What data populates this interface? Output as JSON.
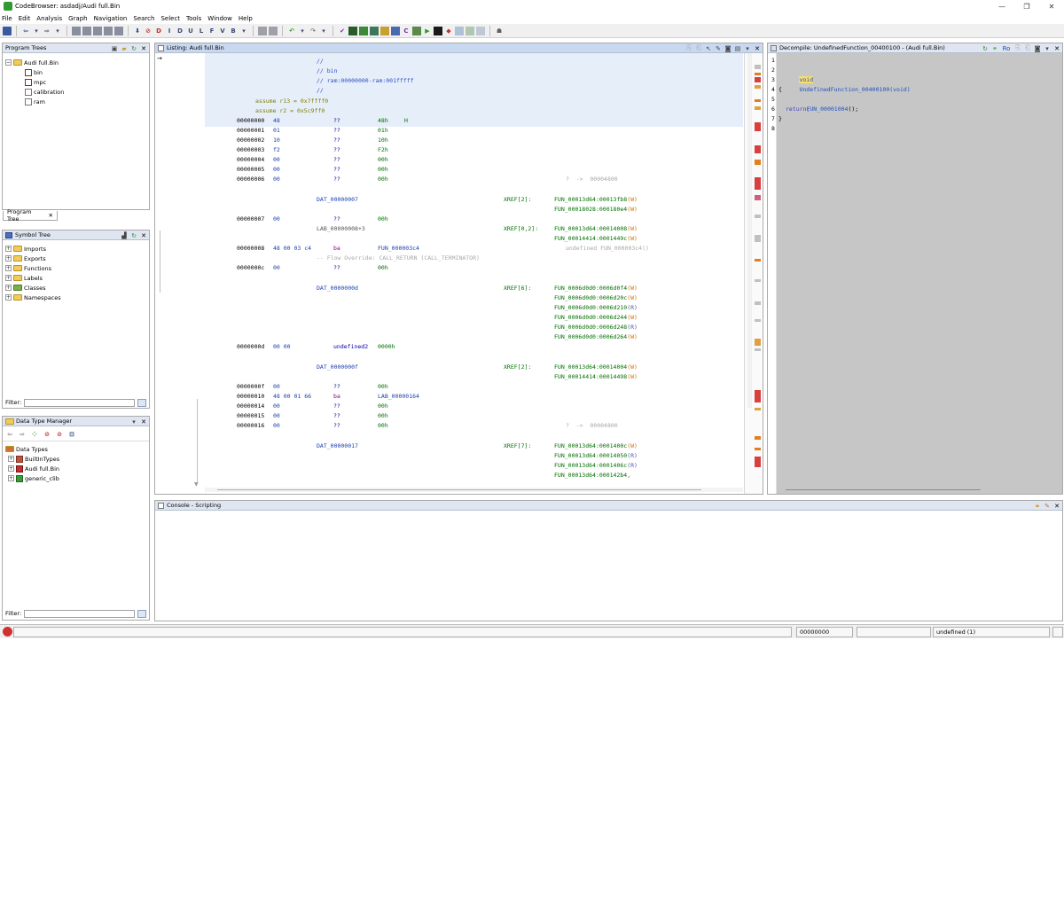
{
  "window": {
    "title": "CodeBrowser: asdadj/Audi full.Bin",
    "controls": [
      "—",
      "❐",
      "✕"
    ]
  },
  "menu": [
    "File",
    "Edit",
    "Analysis",
    "Graph",
    "Navigation",
    "Search",
    "Select",
    "Tools",
    "Window",
    "Help"
  ],
  "program_trees": {
    "header": "Program Trees",
    "root": "Audi full.Bin",
    "items": [
      "bin",
      "mpc",
      "calibration",
      "ram"
    ],
    "tab_label": "Program Tree"
  },
  "symbol_tree": {
    "header": "Symbol Tree",
    "items": [
      "Imports",
      "Exports",
      "Functions",
      "Labels",
      "Classes",
      "Namespaces"
    ],
    "filter_label": "Filter:"
  },
  "data_type_manager": {
    "header": "Data Type Manager",
    "root": "Data Types",
    "items": [
      "BuiltInTypes",
      "Audi full.Bin",
      "generic_clib"
    ],
    "filter_label": "Filter:"
  },
  "listing": {
    "header": "Listing:  Audi full.Bin",
    "comments": [
      "//",
      "// bin",
      "// ram:00000000-ram:001fffff",
      "//"
    ],
    "assumes": [
      "assume r13 = 0x7ffff0",
      "assume r2 = 0x5c9ff0"
    ],
    "first_row": {
      "addr": "00000000",
      "bytes": "48",
      "mnem": "??",
      "oper": "48h",
      "extra": "H"
    },
    "rows": [
      {
        "addr": "00000001",
        "bytes": "01",
        "mnem": "??",
        "oper": "01h"
      },
      {
        "addr": "00000002",
        "bytes": "10",
        "mnem": "??",
        "oper": "10h"
      },
      {
        "addr": "00000003",
        "bytes": "f2",
        "mnem": "??",
        "oper": "F2h"
      },
      {
        "addr": "00000004",
        "bytes": "00",
        "mnem": "??",
        "oper": "00h"
      },
      {
        "addr": "00000005",
        "bytes": "00",
        "mnem": "??",
        "oper": "00h"
      },
      {
        "addr": "00000006",
        "bytes": "00",
        "mnem": "??",
        "oper": "00h",
        "ptr": "?  ->  00004800"
      }
    ],
    "dat7": {
      "label": "DAT_00000007",
      "xref_label": "XREF[2]:",
      "xrefs": [
        {
          "text": "FUN_00013d64:00013fb8",
          "mode": "(W)"
        },
        {
          "text": "FUN_00018028:000180e4",
          "mode": "(W)"
        }
      ],
      "row": {
        "addr": "00000007",
        "bytes": "00",
        "mnem": "??",
        "oper": "00h"
      }
    },
    "lab8": {
      "label": "LAB_00000008+3",
      "xref_label": "XREF[0,2]:",
      "xrefs": [
        {
          "text": "FUN_00013d64:00014008",
          "mode": "(W)"
        },
        {
          "text": "FUN_00014414:0001449c",
          "mode": "(W)"
        }
      ],
      "row": {
        "addr": "00000008",
        "bytes": "48 00 03 c4",
        "mnem": "ba",
        "oper": "FUN_000003c4"
      },
      "undefined_note": "undefined FUN_000003c4()",
      "flow_override": "-- Flow Override: CALL_RETURN (CALL_TERMINATOR)",
      "row_c": {
        "addr": "0000000c",
        "bytes": "00",
        "mnem": "??",
        "oper": "00h"
      }
    },
    "datd": {
      "label": "DAT_0000000d",
      "xref_label": "XREF[6]:",
      "xrefs": [
        {
          "text": "FUN_0006d0d0:0006d0f4",
          "mode": "(W)"
        },
        {
          "text": "FUN_0006d0d0:0006d20c",
          "mode": "(W)"
        },
        {
          "text": "FUN_0006d0d0:0006d210",
          "mode": "(R)"
        },
        {
          "text": "FUN_0006d0d0:0006d244",
          "mode": "(W)"
        },
        {
          "text": "FUN_0006d0d0:0006d248",
          "mode": "(R)"
        },
        {
          "text": "FUN_0006d0d0:0006d264",
          "mode": "(W)"
        }
      ],
      "row": {
        "addr": "0000000d",
        "bytes": "00 00",
        "mnem": "undefined2",
        "oper": "0000h"
      }
    },
    "datf": {
      "label": "DAT_0000000f",
      "xref_label": "XREF[2]:",
      "xrefs": [
        {
          "text": "FUN_00013d64:00014004",
          "mode": "(W)"
        },
        {
          "text": "FUN_00014414:00014498",
          "mode": "(W)"
        }
      ],
      "rows": [
        {
          "addr": "0000000f",
          "bytes": "00",
          "mnem": "??",
          "oper": "00h"
        },
        {
          "addr": "00000010",
          "bytes": "48 00 01 66",
          "mnem": "ba",
          "oper": "LAB_00000164"
        },
        {
          "addr": "00000014",
          "bytes": "00",
          "mnem": "??",
          "oper": "00h"
        },
        {
          "addr": "00000015",
          "bytes": "00",
          "mnem": "??",
          "oper": "00h"
        },
        {
          "addr": "00000016",
          "bytes": "00",
          "mnem": "??",
          "oper": "00h",
          "ptr": "?  ->  00004800"
        }
      ]
    },
    "dat17": {
      "label": "DAT_00000017",
      "xref_label": "XREF[7]:",
      "xrefs": [
        {
          "text": "FUN_00013d64:0001400c",
          "mode": "(W)"
        },
        {
          "text": "FUN_00013d64:00014050",
          "mode": "(R)"
        },
        {
          "text": "FUN_00013d64:0001406c",
          "mode": "(R)"
        },
        {
          "text": "FUN_00013d64:000142b4",
          "mode": ""
        }
      ]
    }
  },
  "decompile": {
    "header": "Decompile: UndefinedFunction_00400100 - (Audi full.Bin)",
    "ro_label": "Ro",
    "line_numbers": [
      "1",
      "2",
      "3",
      "4",
      "5",
      "6",
      "7",
      "8"
    ],
    "signature_type": "void",
    "signature_name": "UndefinedFunction_00400100",
    "signature_params": "(void)",
    "open_brace": "{",
    "call_name": "FUN_00001004",
    "call_tail": "();",
    "return_stmt": "return;",
    "close_brace": "}"
  },
  "console": {
    "header": "Console - Scripting"
  },
  "status": {
    "address": "00000000",
    "type_info": "undefined  (1)"
  },
  "colors": {
    "panel_header": "#dfe6f1",
    "listing_highlight": "#e6eefa",
    "decompile_bg": "#c6c6c6"
  }
}
